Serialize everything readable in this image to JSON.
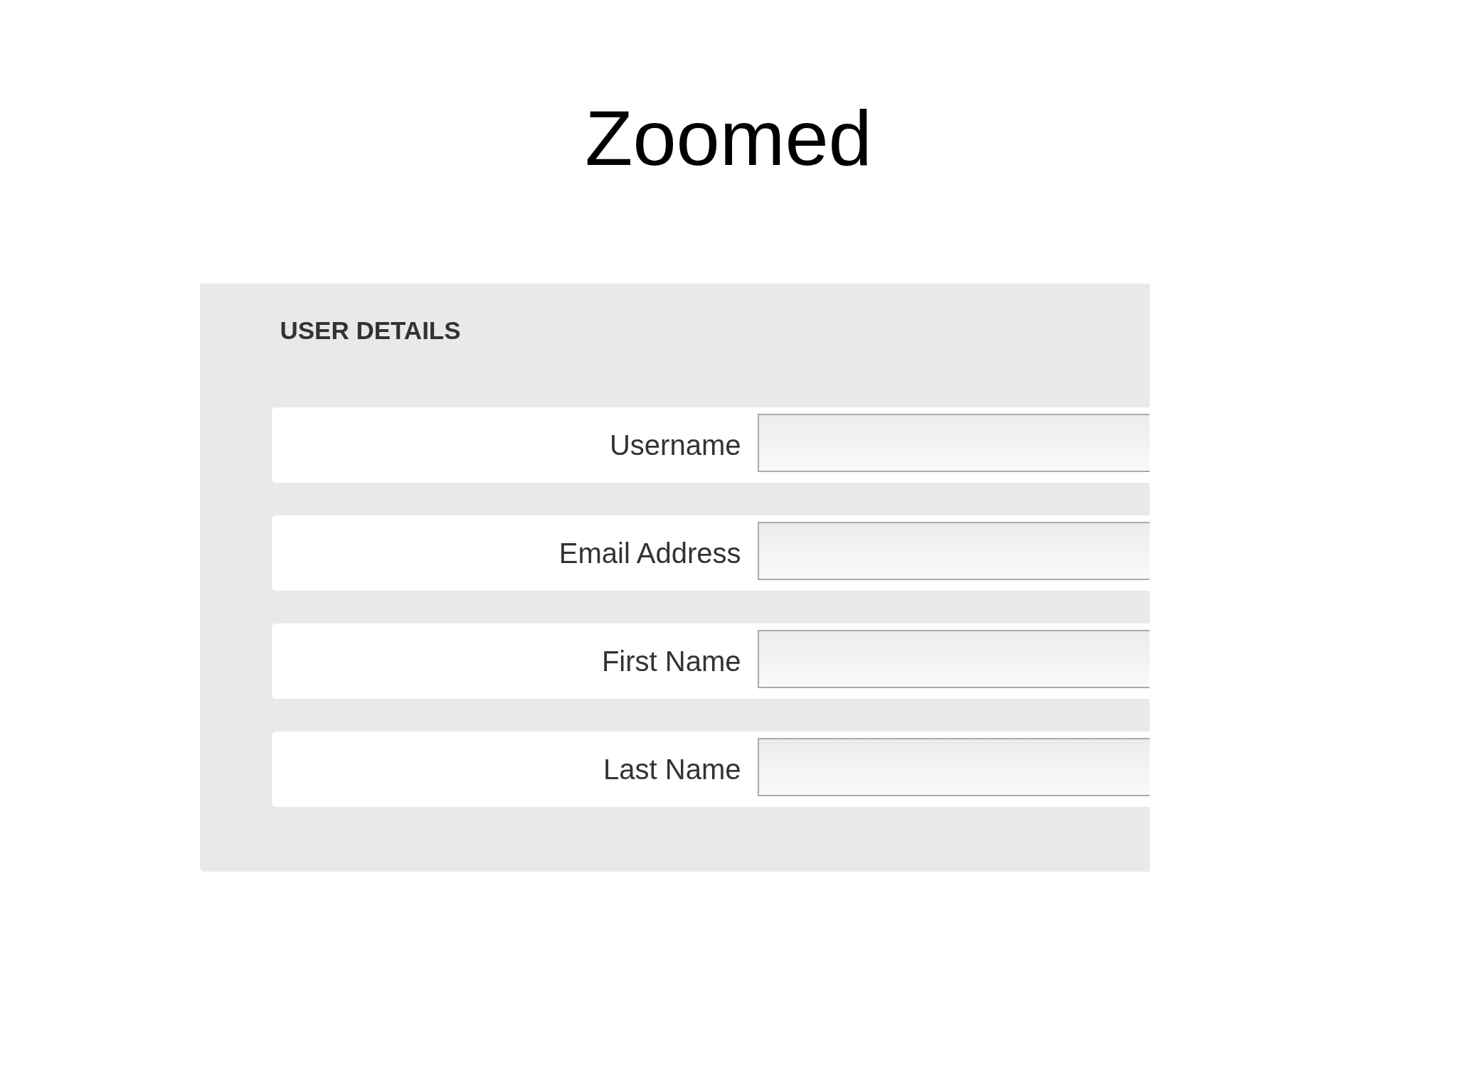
{
  "title": "Zoomed",
  "panel": {
    "heading": "USER DETAILS",
    "fields": [
      {
        "label": "Username"
      },
      {
        "label": "Email Address"
      },
      {
        "label": "First Name"
      },
      {
        "label": "Last Name"
      }
    ]
  }
}
